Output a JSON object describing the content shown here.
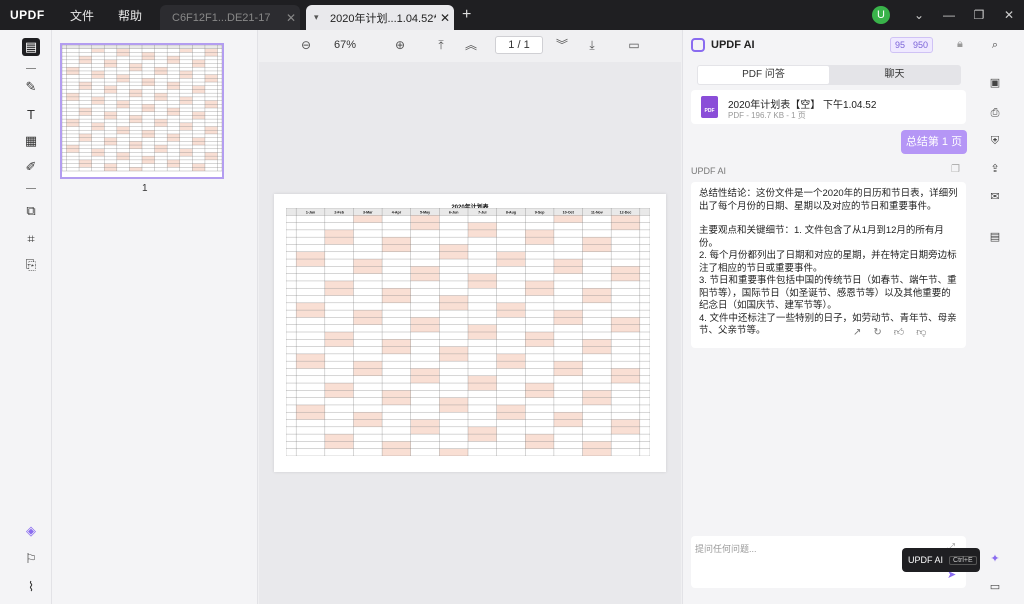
{
  "app": {
    "logo": "UPDF",
    "menus": [
      "文件",
      "帮助"
    ]
  },
  "tabs": [
    {
      "label": "C6F12F1...DE21-17",
      "active": false
    },
    {
      "label": "2020年计划...1.04.52*",
      "active": true
    }
  ],
  "titlebar": {
    "avatar": "U"
  },
  "viewer": {
    "zoom": "67%",
    "page_current": "1",
    "page_total": "1",
    "page_sep": "/",
    "thumb_number": "1"
  },
  "document": {
    "title": "2020年计划表",
    "months": [
      "1-Jan",
      "2-Feb",
      "3-Mar",
      "4-Apr",
      "5-May",
      "6-Jun",
      "7-Jul",
      "8-Aug",
      "9-Sep",
      "10-Oct",
      "11-Nov",
      "12-Dec"
    ],
    "colors": {
      "highlight": "#f9dfd4",
      "header": "#e9e9e9",
      "grid": "#777777"
    }
  },
  "ai": {
    "title": "UPDF AI",
    "credits": [
      "95",
      "950"
    ],
    "tabs": [
      "PDF 问答",
      "聊天"
    ],
    "file_name": "2020年计划表【空】 下午1.04.52",
    "file_meta": "PDF - 196.7 KB - 1 页",
    "pdf_badge": "PDF",
    "summary_button": "总结第 1 页",
    "responder": "UPDF AI",
    "answer_intro": "总结性结论：这份文件是一个2020年的日历和节日表，详细列出了每个月份的日期、星期以及对应的节日和重要事件。",
    "answer_points": [
      "主要观点和关键细节：1. 文件包含了从1月到12月的所有月份。",
      "2. 每个月份都列出了日期和对应的星期，并在特定日期旁边标注了相应的节日或重要事件。",
      "3. 节日和重要事件包括中国的传统节日（如春节、端午节、重阳节等），国际节日（如圣诞节、感恩节等）以及其他重要的纪念日（如国庆节、建军节等）。",
      "4. 文件中还标注了一些特别的日子，如劳动节、青年节、母亲节、父亲节等。"
    ],
    "input_placeholder": "提问任何问题...",
    "accent": "#8a6cf0"
  },
  "tooltip": {
    "label": "UPDF AI",
    "shortcut": "Ctrl+E"
  }
}
